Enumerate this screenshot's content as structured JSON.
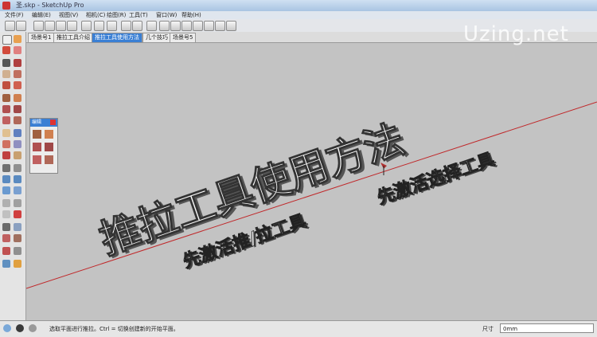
{
  "window": {
    "title": "圣.skp - SketchUp Pro"
  },
  "menu": [
    "文件(F)",
    "编辑(E)",
    "视图(V)",
    "相机(C)",
    "绘图(R)",
    "工具(T)",
    "窗口(W)",
    "帮助(H)"
  ],
  "scene_tabs": [
    "场景号1",
    "推拉工具介绍",
    "推拉工具使用方法",
    "几个技巧",
    "场景号5"
  ],
  "active_tab_index": 2,
  "panel": {
    "title": "编辑"
  },
  "overlay": {
    "headline": "推拉工具使用方法",
    "sub1": "先激活推/拉工具",
    "sub2": "先激活选择工具"
  },
  "watermark": "Uzing.net",
  "status": {
    "text": "选取平面进行推拉。Ctrl = 切换创建新的开始平面。",
    "measure_label": "尺寸",
    "measure_value": "0mm"
  },
  "colors": {
    "accent": "#3a7fd4",
    "axis_red": "#c0282a",
    "viewport": "#c3c3c3"
  }
}
